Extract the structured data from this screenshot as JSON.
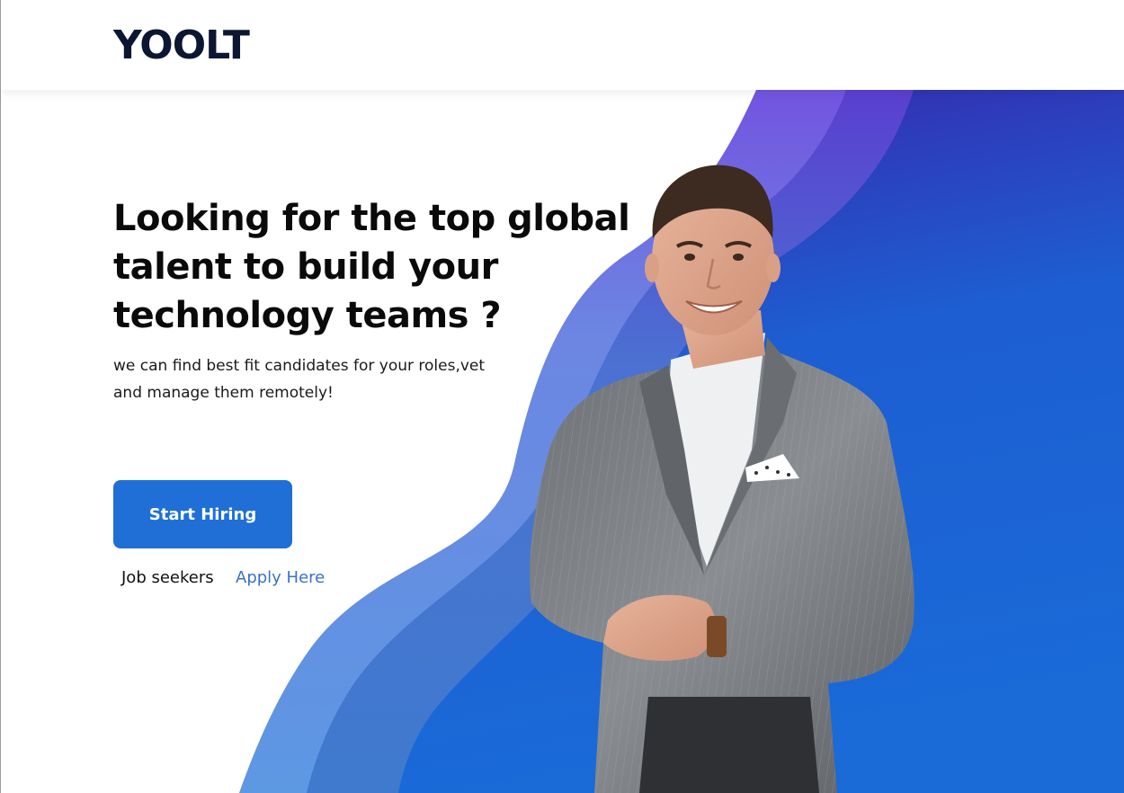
{
  "header": {
    "logo_text": "YOOLT"
  },
  "hero": {
    "title": "Looking for the top global talent to build your technology teams ?",
    "subtitle": "we can find best fit candidates for your roles,vet and manage them remotely!",
    "cta_label": "Start Hiring",
    "job_seekers_label": "Job seekers",
    "apply_link_label": "Apply Here",
    "image_subject": "smiling man in grey pinstripe suit"
  },
  "colors": {
    "logo": "#0b1633",
    "primary_button": "#1f6fd6",
    "link": "#3a72c8",
    "wave_light": "#5f98e2",
    "wave_mid": "#4179ce",
    "gradient_top": "#3a22a8",
    "gradient_bottom": "#1a6ad8"
  },
  "icons": {
    "hero_image": "person-photo"
  }
}
